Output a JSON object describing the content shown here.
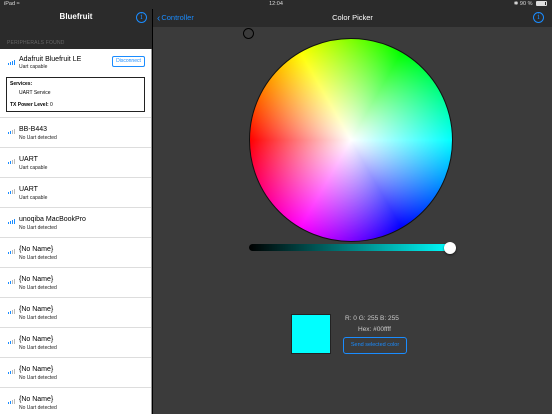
{
  "status_bar": {
    "device": "iPad",
    "wifi_icon": "wifi-icon",
    "time": "12:04",
    "bluetooth_icon": "bluetooth-icon",
    "battery_percent": "90 %"
  },
  "sidebar": {
    "title": "Bluefruit",
    "section_header": "PERIPHERALS FOUND",
    "connected_peripheral": {
      "name": "Adafruit Bluefruit LE",
      "subtitle": "Uart capable",
      "disconnect_label": "Disconnect",
      "services_label": "Services:",
      "service_name": "UART Service",
      "tx_power_label": "TX Power Level:",
      "tx_power_value": "0"
    },
    "peripherals": [
      {
        "name": "BB-B443",
        "subtitle": "No Uart detected",
        "signal": "weak"
      },
      {
        "name": "UART",
        "subtitle": "Uart capable",
        "signal": "weak"
      },
      {
        "name": "UART",
        "subtitle": "Uart capable",
        "signal": "weak"
      },
      {
        "name": "unoqiba MacBookPro",
        "subtitle": "No Uart detected",
        "signal": "strong"
      },
      {
        "name": "{No Name}",
        "subtitle": "No Uart detected",
        "signal": "weak"
      },
      {
        "name": "{No Name}",
        "subtitle": "No Uart detected",
        "signal": "weak"
      },
      {
        "name": "{No Name}",
        "subtitle": "No Uart detected",
        "signal": "weak"
      },
      {
        "name": "{No Name}",
        "subtitle": "No Uart detected",
        "signal": "weak"
      },
      {
        "name": "{No Name}",
        "subtitle": "No Uart detected",
        "signal": "weak"
      },
      {
        "name": "{No Name}",
        "subtitle": "No Uart detected",
        "signal": "weak"
      }
    ]
  },
  "main": {
    "back_label": "Controller",
    "title": "Color Picker",
    "selected_color": {
      "rgb_text": "R: 0  G: 255  B: 255",
      "hex_text": "Hex: #00ffff",
      "hex": "#00ffff"
    },
    "brightness_level": 1.0,
    "send_button_label": "Send selected color"
  },
  "colors": {
    "accent": "#1a8cff",
    "header_bg": "#2b2b2b",
    "panel_bg": "#3b3b3b"
  }
}
